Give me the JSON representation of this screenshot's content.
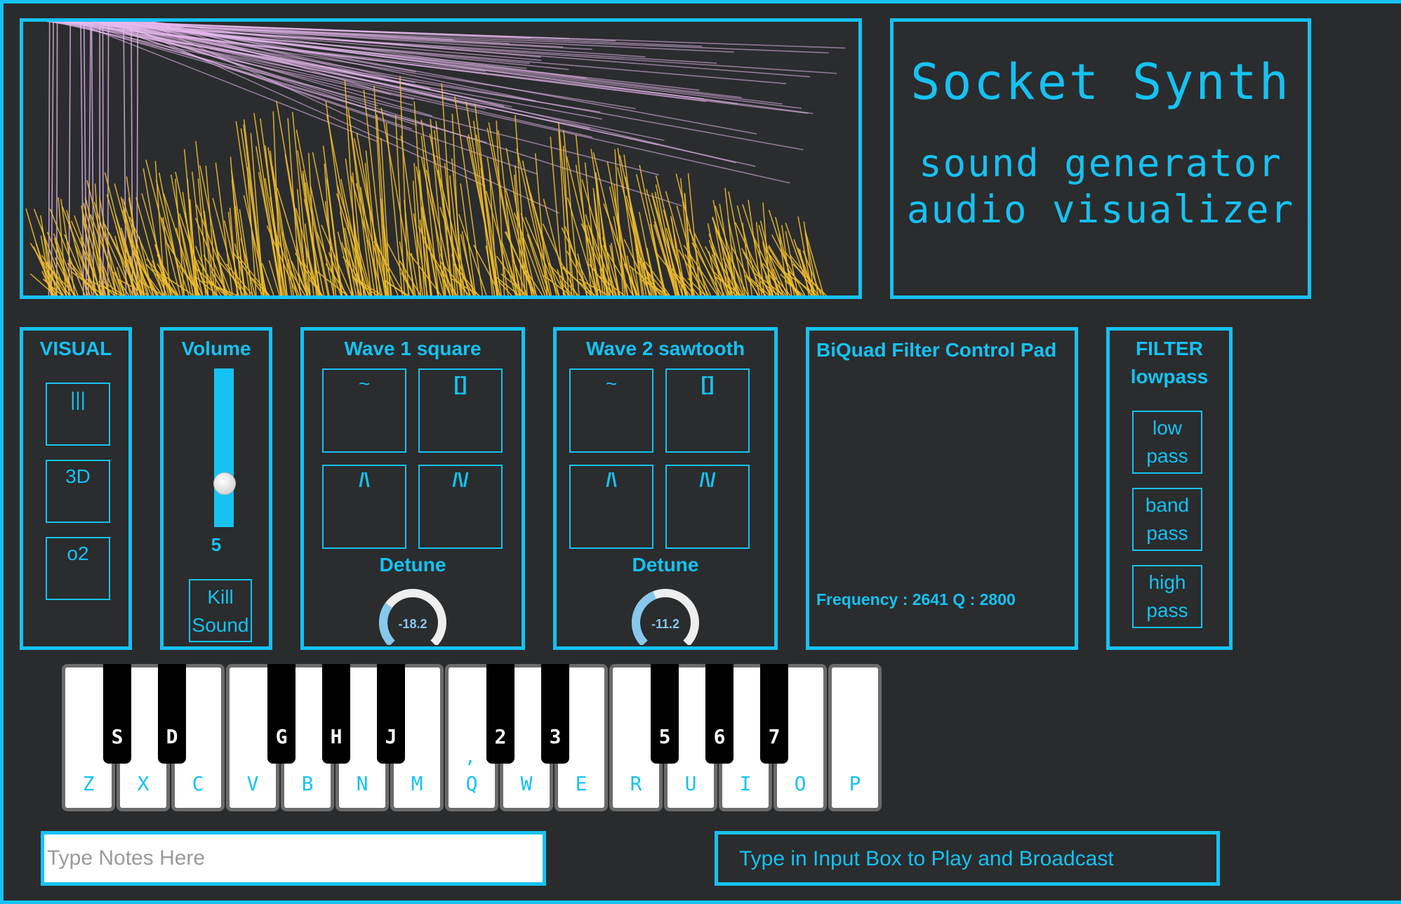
{
  "title": {
    "app_name": "Socket Synth",
    "line1": "sound generator",
    "line2": "audio visualizer"
  },
  "colors": {
    "accent": "#16c2f2",
    "background": "#292b2d",
    "viz_yellow": "#f2be2e",
    "viz_pink": "#e7b9ee"
  },
  "visual_panel": {
    "title": "VISUAL",
    "buttons": [
      "|||",
      "3D",
      "o2"
    ]
  },
  "volume_panel": {
    "title": "Volume",
    "value": "5",
    "level_fraction": 0.5,
    "kill_label_1": "Kill",
    "kill_label_2": "Sound"
  },
  "wave1": {
    "title": "Wave 1 square",
    "buttons": [
      "~",
      "[]",
      "/\\",
      "/\\/"
    ],
    "detune_label": "Detune",
    "detune_value": "-18.2",
    "detune_fraction": 0.3
  },
  "wave2": {
    "title": "Wave 2 sawtooth",
    "buttons": [
      "~",
      "[]",
      "/\\",
      "/\\/"
    ],
    "detune_label": "Detune",
    "detune_value": "-11.2",
    "detune_fraction": 0.42
  },
  "filter_pad": {
    "title": "BiQuad Filter Control Pad",
    "readout": "Frequency : 2641 Q : 2800"
  },
  "filter_panel": {
    "title_1": "FILTER",
    "title_2": "lowpass",
    "buttons": [
      {
        "line1": "low",
        "line2": "pass"
      },
      {
        "line1": "band",
        "line2": "pass"
      },
      {
        "line1": "high",
        "line2": "pass"
      }
    ]
  },
  "keyboard": {
    "white_keys": [
      "Z",
      "X",
      "C",
      "V",
      "B",
      "N",
      "M",
      "Q",
      "W",
      "E",
      "R",
      "U",
      "I",
      "O",
      "P"
    ],
    "black_keys": [
      "S",
      "D",
      "G",
      "H",
      "J",
      "2",
      "3",
      "5",
      "6",
      "7"
    ],
    "comma": ","
  },
  "input": {
    "placeholder": "Type Notes Here",
    "value": ""
  },
  "broadcast": {
    "message": "Type in Input Box to Play and Broadcast"
  }
}
